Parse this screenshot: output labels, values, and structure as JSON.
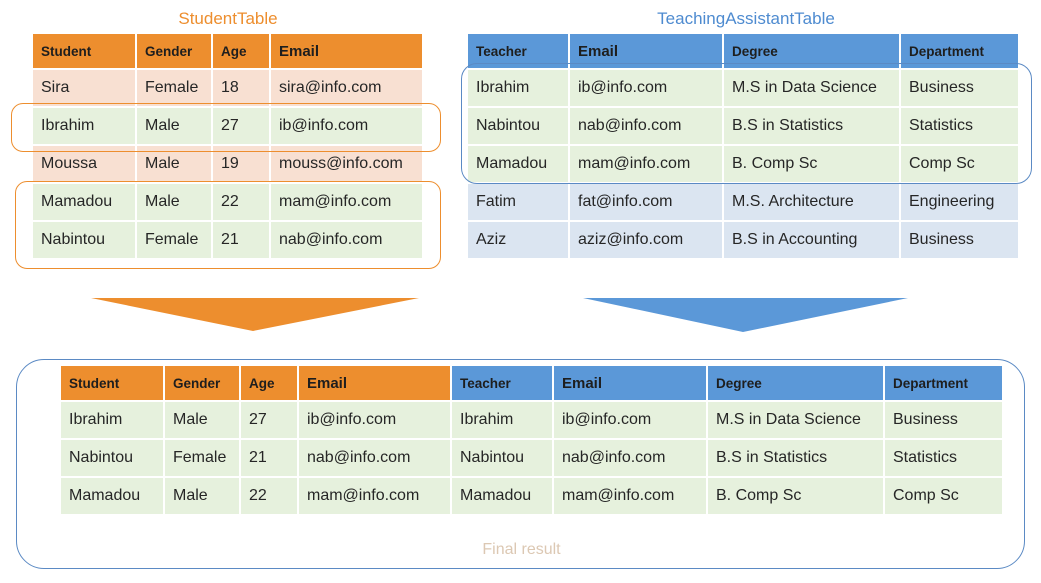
{
  "student_table": {
    "title": "StudentTable",
    "headers": [
      "Student",
      "Gender",
      "Age",
      "Email"
    ],
    "rows": [
      [
        "Sira",
        "Female",
        "18",
        "sira@info.com"
      ],
      [
        "Ibrahim",
        "Male",
        "27",
        "ib@info.com"
      ],
      [
        "Moussa",
        "Male",
        "19",
        "mouss@info.com"
      ],
      [
        "Mamadou",
        "Male",
        "22",
        "mam@info.com"
      ],
      [
        "Nabintou",
        "Female",
        "21",
        "nab@info.com"
      ]
    ]
  },
  "ta_table": {
    "title": "TeachingAssistantTable",
    "headers": [
      "Teacher",
      "Email",
      "Degree",
      "Department"
    ],
    "rows": [
      [
        "Ibrahim",
        "ib@info.com",
        "M.S in Data Science",
        "Business"
      ],
      [
        "Nabintou",
        "nab@info.com",
        "B.S in Statistics",
        "Statistics"
      ],
      [
        "Mamadou",
        "mam@info.com",
        "B. Comp Sc",
        "Comp Sc"
      ],
      [
        "Fatim",
        "fat@info.com",
        "M.S. Architecture",
        "Engineering"
      ],
      [
        "Aziz",
        "aziz@info.com",
        "B.S in Accounting",
        "Business"
      ]
    ]
  },
  "final_table": {
    "title": "Final result",
    "headers": [
      "Student",
      "Gender",
      "Age",
      "Email",
      "Teacher",
      "Email",
      "Degree",
      "Department"
    ],
    "rows": [
      [
        "Ibrahim",
        "Male",
        "27",
        "ib@info.com",
        "Ibrahim",
        "ib@info.com",
        "M.S in Data Science",
        "Business"
      ],
      [
        "Nabintou",
        "Female",
        "21",
        "nab@info.com",
        "Nabintou",
        "nab@info.com",
        "B.S in Statistics",
        "Statistics"
      ],
      [
        "Mamadou",
        "Male",
        "22",
        "mam@info.com",
        "Mamadou",
        "mam@info.com",
        "B. Comp Sc",
        "Comp Sc"
      ]
    ]
  },
  "colors": {
    "orange": "#ed8e2e",
    "blue": "#5b98d8",
    "peach_row": "#f8e0d2",
    "green_row": "#e6f1dd",
    "blue_row": "#dbe5f1"
  }
}
